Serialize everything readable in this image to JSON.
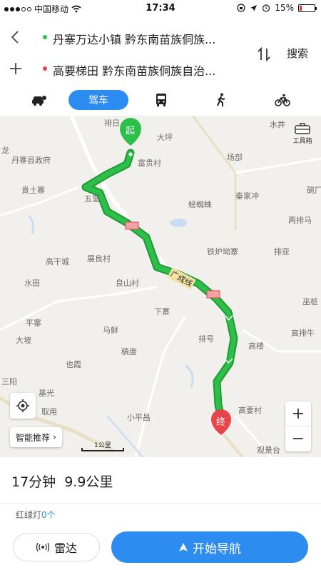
{
  "status_bar": {
    "carrier": "中国移动",
    "time": "17:34",
    "battery": "15%",
    "battery_level": 0.15
  },
  "route": {
    "origin": "丹寨万达小镇  黔东南苗族侗族...",
    "destination": "高要梯田  黔东南苗族侗族自治...",
    "search_label": "搜索"
  },
  "modes": {
    "active_label": "驾车",
    "items": [
      "car-taxi-icon",
      "drive",
      "bus-icon",
      "walk-icon",
      "bike-icon"
    ]
  },
  "map": {
    "start_label": "起",
    "end_label": "终",
    "road_label": "广成线",
    "toolbox_label": "工具箱",
    "places": [
      "排日",
      "大坪",
      "丹寨县政府",
      "水井",
      "富贵村",
      "场部",
      "龙",
      "貴土寨",
      "五里",
      "碗厂",
      "秦家冲",
      "螃蜘蛛",
      "两排马",
      "高干城",
      "展良村",
      "铁炉坳寨",
      "排亚",
      "水田",
      "良山村",
      "平寨",
      "下寨",
      "大坡",
      "马鲜",
      "巫桩",
      "高排牛",
      "也霞",
      "稿度",
      "排号",
      "高楼",
      "三阳",
      "基光",
      "高要村",
      "小平昌",
      "取用",
      "观景台"
    ],
    "smart_recommend": "智能推荐",
    "scale_label": "1公里",
    "zoom_in": "+",
    "zoom_out": "−"
  },
  "summary": {
    "time": "17分钟",
    "distance": "9.9公里",
    "traffic_lights_label": "红绿灯",
    "traffic_lights_count": "0个"
  },
  "actions": {
    "radar": "雷达",
    "start_nav": "开始导航"
  },
  "colors": {
    "accent": "#2d8cf0",
    "route_green": "#2dbf4a",
    "start_pin": "#2dbf4a",
    "end_pin": "#e8454a"
  }
}
